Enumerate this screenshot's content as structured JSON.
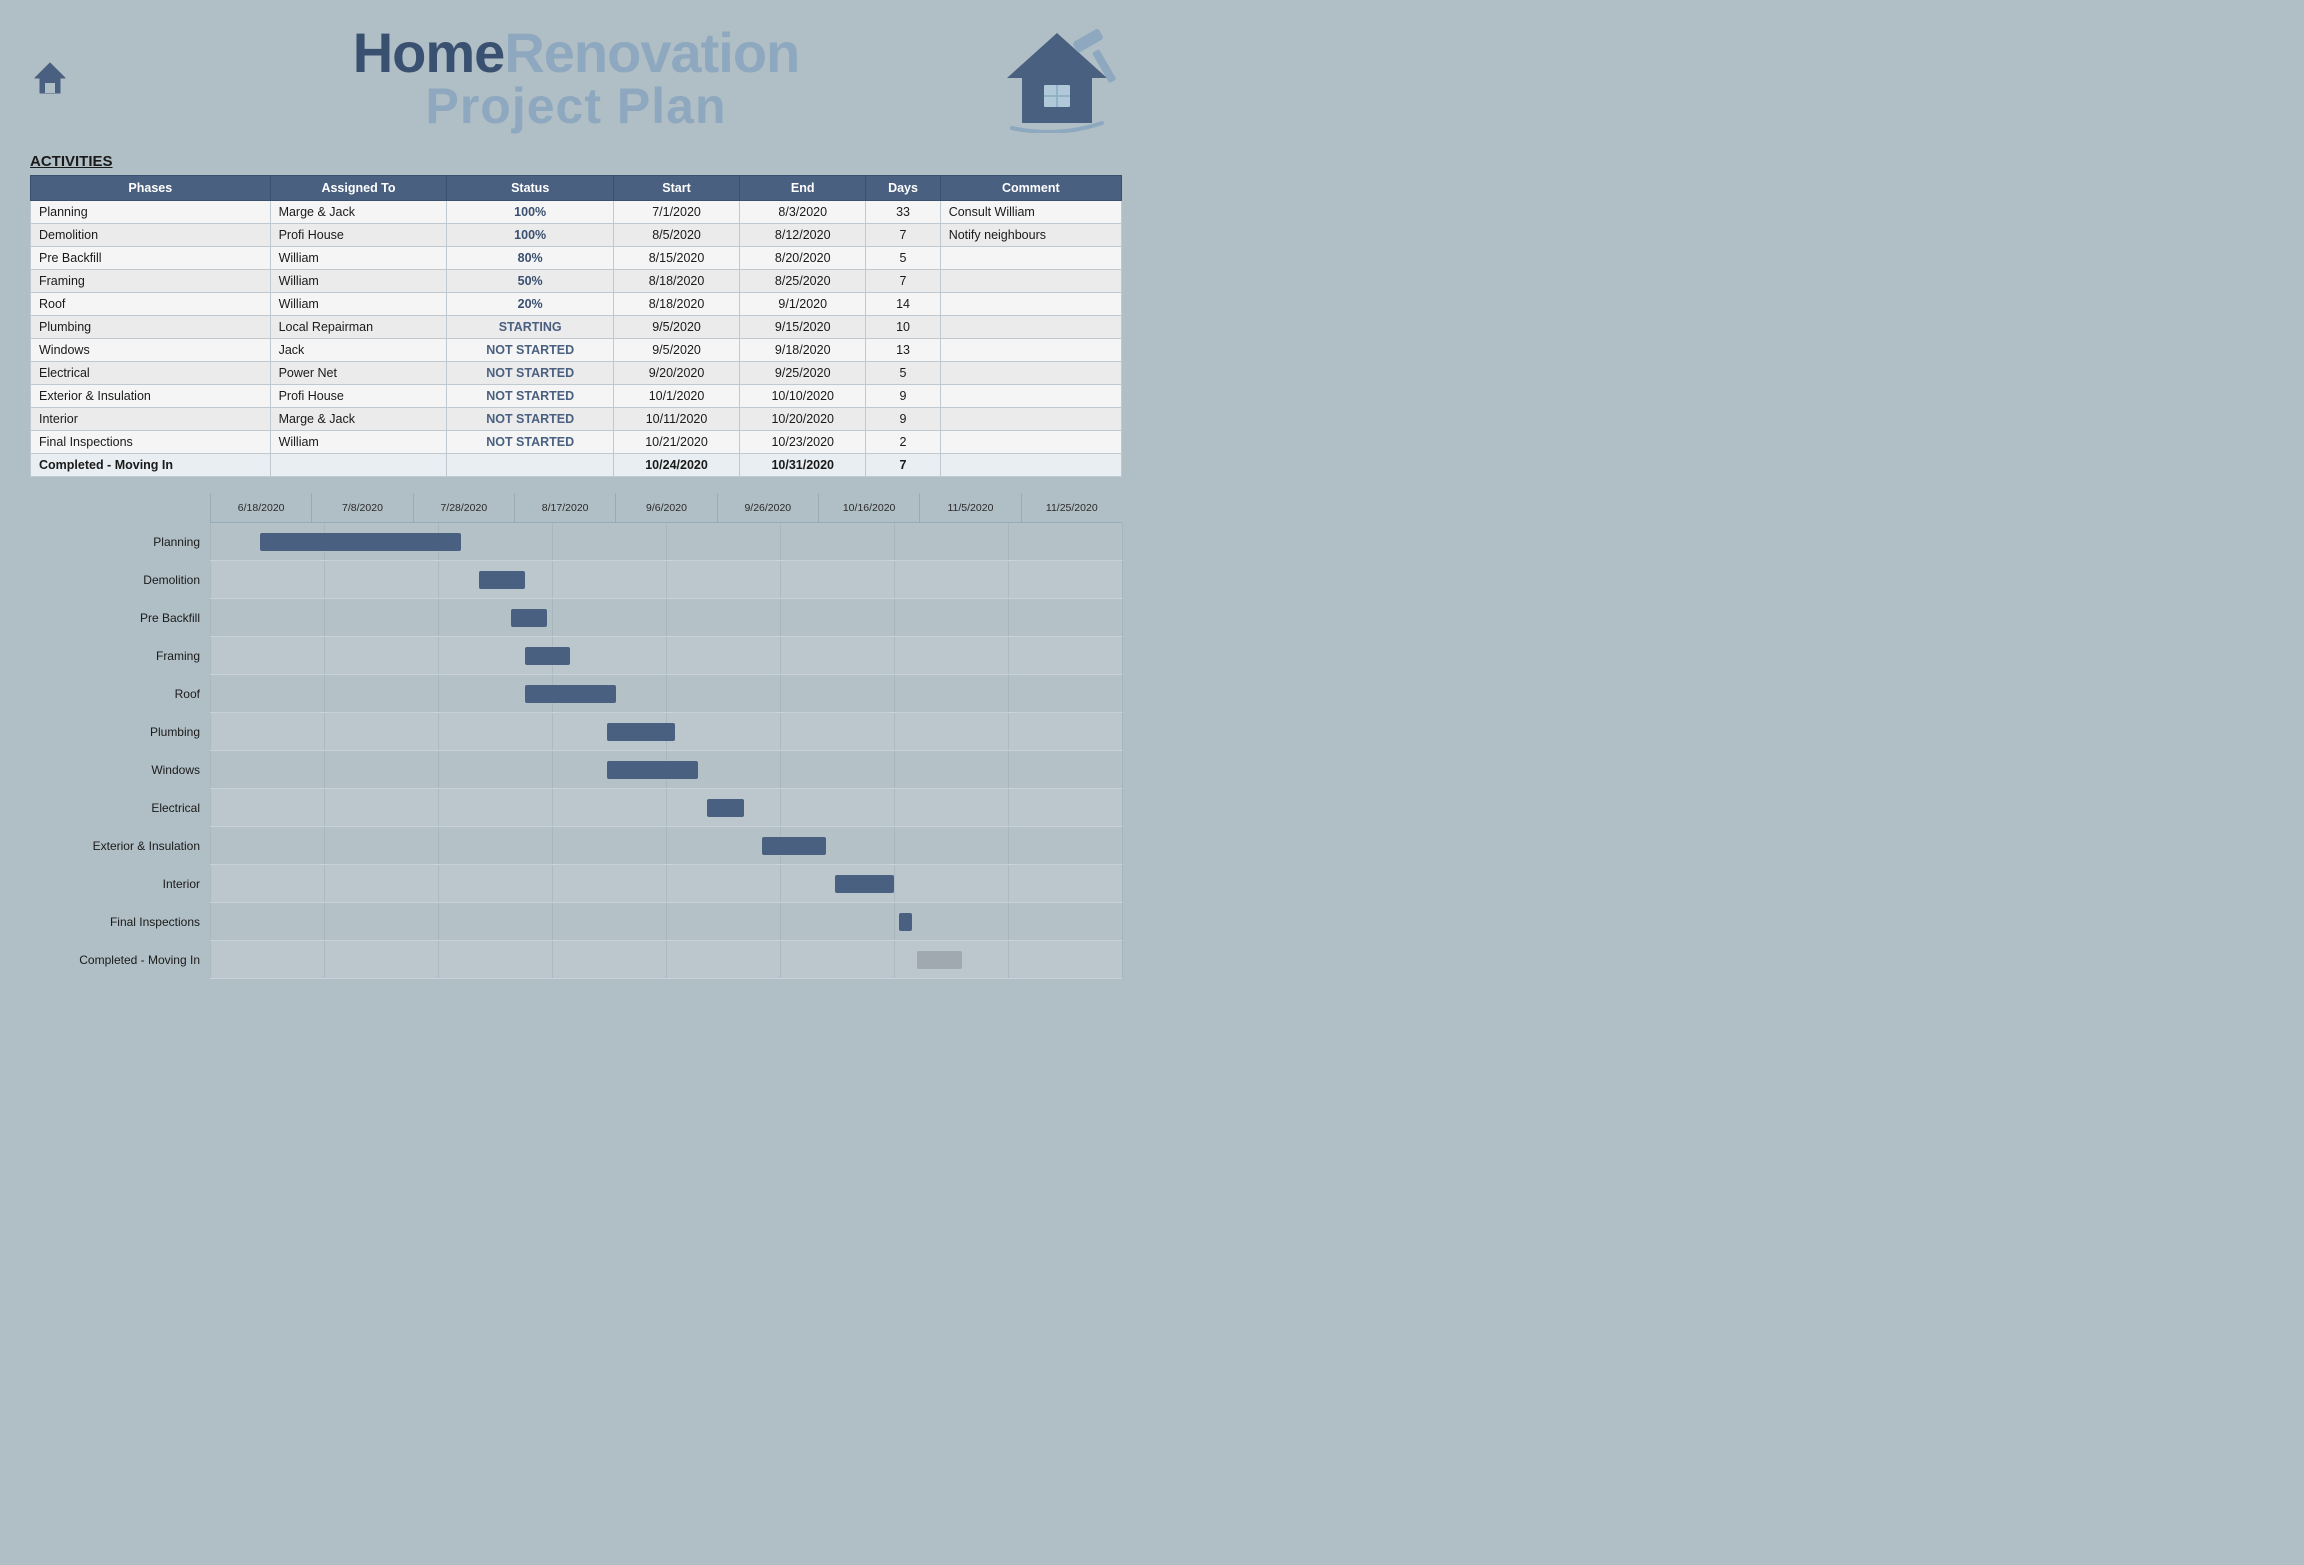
{
  "header": {
    "title_home": "Home",
    "title_renovation": "Renovation",
    "title_line2": "Project Plan"
  },
  "activities_label": "ACTIVITIES",
  "table": {
    "columns": [
      "Phases",
      "Assigned To",
      "Status",
      "Start",
      "End",
      "Days",
      "Comment"
    ],
    "rows": [
      {
        "phase": "Planning",
        "assigned": "Marge & Jack",
        "status": "100%",
        "status_class": "status-100",
        "start": "7/1/2020",
        "end": "8/3/2020",
        "days": "33",
        "comment": "Consult William"
      },
      {
        "phase": "Demolition",
        "assigned": "Profi House",
        "status": "100%",
        "status_class": "status-100",
        "start": "8/5/2020",
        "end": "8/12/2020",
        "days": "7",
        "comment": "Notify neighbours"
      },
      {
        "phase": "Pre Backfill",
        "assigned": "William",
        "status": "80%",
        "status_class": "status-80",
        "start": "8/15/2020",
        "end": "8/20/2020",
        "days": "5",
        "comment": ""
      },
      {
        "phase": "Framing",
        "assigned": "William",
        "status": "50%",
        "status_class": "status-50",
        "start": "8/18/2020",
        "end": "8/25/2020",
        "days": "7",
        "comment": ""
      },
      {
        "phase": "Roof",
        "assigned": "William",
        "status": "20%",
        "status_class": "status-20",
        "start": "8/18/2020",
        "end": "9/1/2020",
        "days": "14",
        "comment": ""
      },
      {
        "phase": "Plumbing",
        "assigned": "Local Repairman",
        "status": "STARTING",
        "status_class": "status-starting",
        "start": "9/5/2020",
        "end": "9/15/2020",
        "days": "10",
        "comment": ""
      },
      {
        "phase": "Windows",
        "assigned": "Jack",
        "status": "NOT STARTED",
        "status_class": "status-not-started",
        "start": "9/5/2020",
        "end": "9/18/2020",
        "days": "13",
        "comment": ""
      },
      {
        "phase": "Electrical",
        "assigned": "Power Net",
        "status": "NOT STARTED",
        "status_class": "status-not-started",
        "start": "9/20/2020",
        "end": "9/25/2020",
        "days": "5",
        "comment": ""
      },
      {
        "phase": "Exterior & Insulation",
        "assigned": "Profi House",
        "status": "NOT STARTED",
        "status_class": "status-not-started",
        "start": "10/1/2020",
        "end": "10/10/2020",
        "days": "9",
        "comment": ""
      },
      {
        "phase": "Interior",
        "assigned": "Marge & Jack",
        "status": "NOT STARTED",
        "status_class": "status-not-started",
        "start": "10/11/2020",
        "end": "10/20/2020",
        "days": "9",
        "comment": ""
      },
      {
        "phase": "Final Inspections",
        "assigned": "William",
        "status": "NOT STARTED",
        "status_class": "status-not-started",
        "start": "10/21/2020",
        "end": "10/23/2020",
        "days": "2",
        "comment": ""
      },
      {
        "phase": "Completed - Moving In",
        "assigned": "",
        "status": "",
        "status_class": "",
        "start": "10/24/2020",
        "end": "10/31/2020",
        "days": "7",
        "comment": "",
        "is_completed": true
      }
    ]
  },
  "gantt": {
    "dates": [
      "6/18/2020",
      "7/8/2020",
      "7/28/2020",
      "8/17/2020",
      "9/6/2020",
      "9/26/2020",
      "10/16/2020",
      "11/5/2020",
      "11/25/2020"
    ],
    "rows": [
      {
        "label": "Planning",
        "bar_color": "blue",
        "left_pct": 5.5,
        "width_pct": 22
      },
      {
        "label": "Demolition",
        "bar_color": "blue",
        "left_pct": 29.5,
        "width_pct": 5
      },
      {
        "label": "Pre Backfill",
        "bar_color": "blue",
        "left_pct": 33,
        "width_pct": 4
      },
      {
        "label": "Framing",
        "bar_color": "blue",
        "left_pct": 34.5,
        "width_pct": 5
      },
      {
        "label": "Roof",
        "bar_color": "blue",
        "left_pct": 34.5,
        "width_pct": 10
      },
      {
        "label": "Plumbing",
        "bar_color": "blue",
        "left_pct": 43.5,
        "width_pct": 7.5
      },
      {
        "label": "Windows",
        "bar_color": "blue",
        "left_pct": 43.5,
        "width_pct": 10
      },
      {
        "label": "Electrical",
        "bar_color": "blue",
        "left_pct": 54.5,
        "width_pct": 4
      },
      {
        "label": "Exterior & Insulation",
        "bar_color": "blue",
        "left_pct": 60.5,
        "width_pct": 7
      },
      {
        "label": "Interior",
        "bar_color": "blue",
        "left_pct": 68.5,
        "width_pct": 6.5
      },
      {
        "label": "Final Inspections",
        "bar_color": "blue",
        "left_pct": 75.5,
        "width_pct": 1.5
      },
      {
        "label": "Completed - Moving In",
        "bar_color": "gray",
        "left_pct": 77.5,
        "width_pct": 5
      }
    ]
  }
}
